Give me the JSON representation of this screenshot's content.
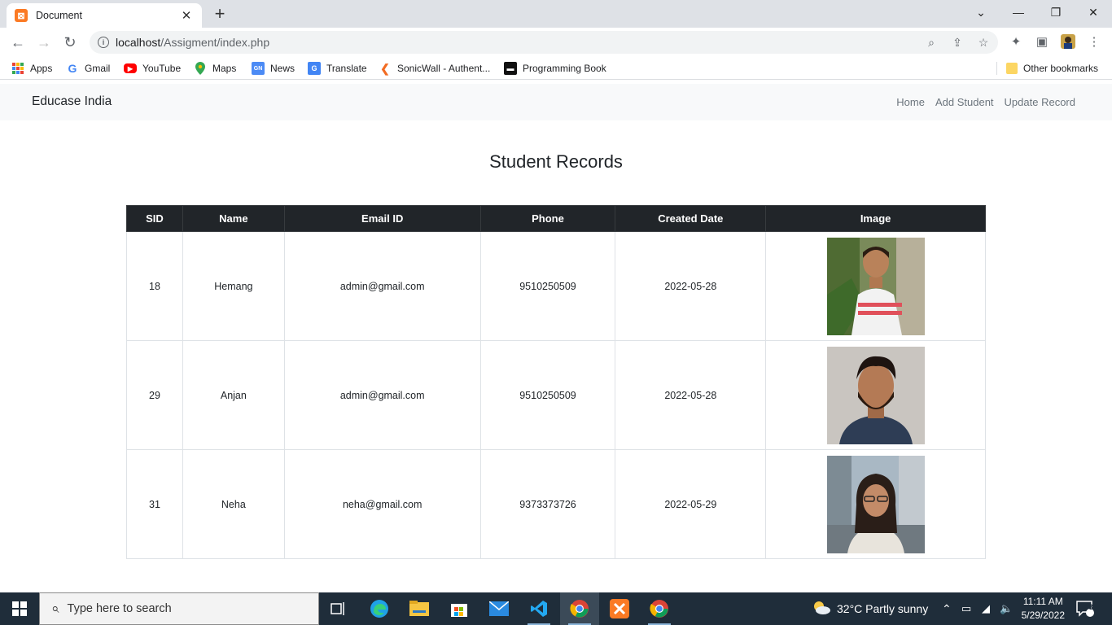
{
  "browser": {
    "tab_title": "Document",
    "tab_favicon": "xampp-icon",
    "url_host": "localhost",
    "url_path": "/Assigment/index.php",
    "bookmarks": [
      {
        "label": "Apps",
        "icon": "apps-grid-icon"
      },
      {
        "label": "Gmail",
        "icon": "google-icon"
      },
      {
        "label": "YouTube",
        "icon": "youtube-icon"
      },
      {
        "label": "Maps",
        "icon": "maps-pin-icon"
      },
      {
        "label": "News",
        "icon": "news-icon"
      },
      {
        "label": "Translate",
        "icon": "translate-icon"
      },
      {
        "label": "SonicWall - Authent...",
        "icon": "sonicwall-icon"
      },
      {
        "label": "Programming Book",
        "icon": "book-icon"
      }
    ],
    "other_bookmarks": "Other bookmarks"
  },
  "site": {
    "brand": "Educase India",
    "nav": [
      "Home",
      "Add Student",
      "Update Record"
    ]
  },
  "page": {
    "title": "Student Records",
    "columns": [
      "SID",
      "Name",
      "Email ID",
      "Phone",
      "Created Date",
      "Image"
    ],
    "rows": [
      {
        "sid": "18",
        "name": "Hemang",
        "email": "admin@gmail.com",
        "phone": "9510250509",
        "created": "2022-05-28"
      },
      {
        "sid": "29",
        "name": "Anjan",
        "email": "admin@gmail.com",
        "phone": "9510250509",
        "created": "2022-05-28"
      },
      {
        "sid": "31",
        "name": "Neha",
        "email": "neha@gmail.com",
        "phone": "9373373726",
        "created": "2022-05-29"
      }
    ]
  },
  "taskbar": {
    "search_placeholder": "Type here to search",
    "weather": "32°C  Partly sunny",
    "time": "11:11 AM",
    "date": "5/29/2022",
    "notifications": "3"
  },
  "colors": {
    "table_header": "#212529",
    "navbar_bg": "#f8f9fa",
    "taskbar_bg": "#1f2d3a"
  }
}
